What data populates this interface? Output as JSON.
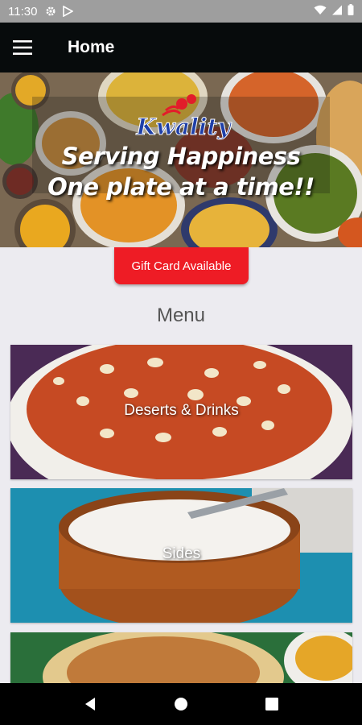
{
  "status_bar": {
    "time": "11:30",
    "icons": [
      "gear-icon",
      "play-store-icon",
      "wifi-icon",
      "signal-icon",
      "battery-icon"
    ]
  },
  "app_bar": {
    "title": "Home",
    "menu_icon": "hamburger-menu-icon"
  },
  "banner": {
    "brand": "Kwality",
    "line1": "Serving Happiness",
    "line2": "One plate at a time!!"
  },
  "gift_card": {
    "label": "Gift Card Available"
  },
  "menu": {
    "heading": "Menu",
    "items": [
      {
        "label": "Deserts & Drinks"
      },
      {
        "label": "Sides"
      },
      {
        "label": ""
      }
    ]
  },
  "nav_bar": {
    "icons": [
      "back-icon",
      "home-icon",
      "recents-icon"
    ]
  },
  "colors": {
    "app_bar": "#070b0c",
    "accent_red": "#ee1c25",
    "background": "#ecebf0",
    "status_bar": "#9e9e9e"
  }
}
